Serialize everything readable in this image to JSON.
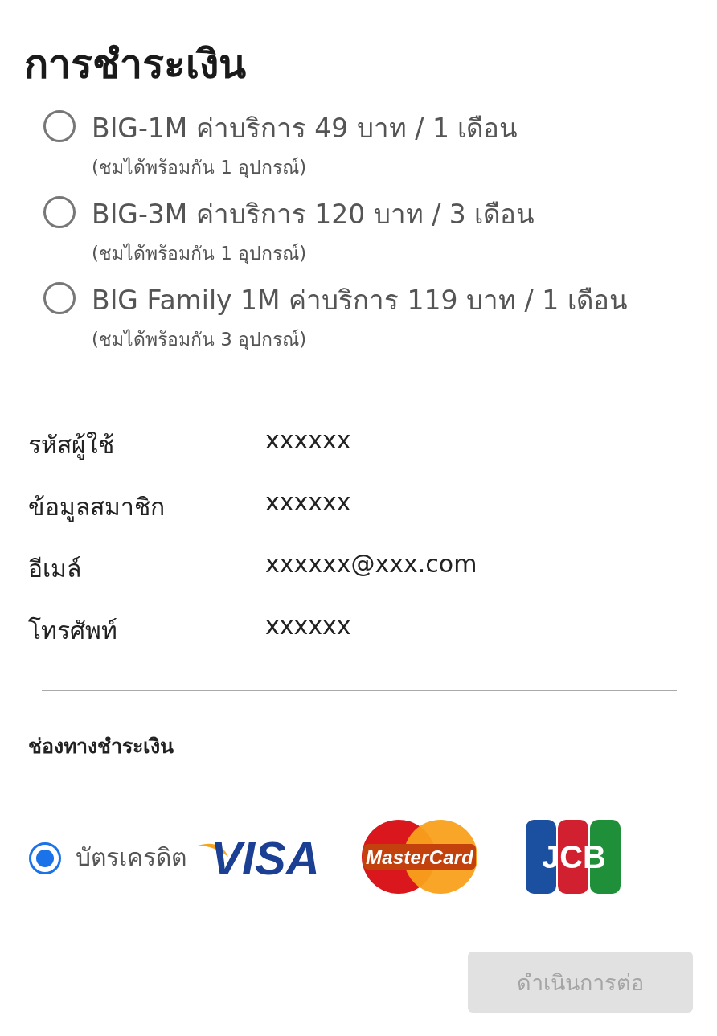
{
  "title": "การชำระเงิน",
  "plans": [
    {
      "label": "BIG-1M ค่าบริการ 49 บาท / 1 เดือน",
      "note": "(ชมได้พร้อมกัน 1 อุปกรณ์)",
      "selected": false
    },
    {
      "label": "BIG-3M ค่าบริการ 120 บาท / 3 เดือน",
      "note": "(ชมได้พร้อมกัน 1 อุปกรณ์)",
      "selected": false
    },
    {
      "label": "BIG Family 1M ค่าบริการ 119 บาท / 1 เดือน",
      "note": "(ชมได้พร้อมกัน 3 อุปกรณ์)",
      "selected": false
    }
  ],
  "info": [
    {
      "label": "รหัสผู้ใช้",
      "value": "xxxxxx"
    },
    {
      "label": "ข้อมูลสมาชิก",
      "value": "xxxxxx"
    },
    {
      "label": "อีเมล์",
      "value": "xxxxxx@xxx.com"
    },
    {
      "label": "โทรศัพท์",
      "value": "xxxxxx"
    }
  ],
  "payment_heading": "ช่องทางชำระเงิน",
  "payment_methods": [
    {
      "label": "บัตรเครดิต",
      "selected": true,
      "cards": [
        {
          "kind": "visa",
          "text": "VISA"
        },
        {
          "kind": "mastercard",
          "text": "MasterCard"
        },
        {
          "kind": "jcb",
          "text": "JCB"
        }
      ]
    }
  ],
  "continue_button": {
    "label": "ดำเนินการต่อ",
    "disabled": true
  }
}
